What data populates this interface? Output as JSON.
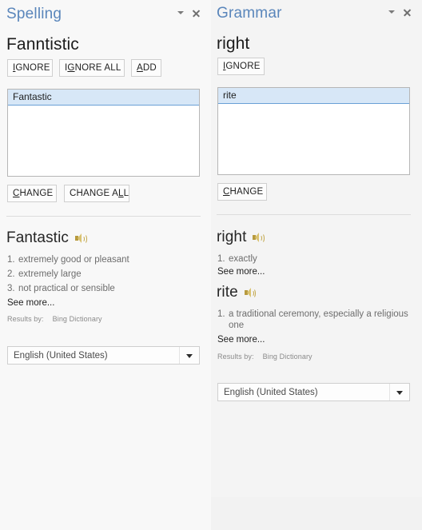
{
  "spelling": {
    "title": "Spelling",
    "header_icons": {
      "collapse": "chevron-down-icon",
      "close": "close-icon"
    },
    "flagged_word": "Fanntistic",
    "actions": [
      {
        "label": "IGNORE",
        "accel": "I"
      },
      {
        "label": "IGNORE ALL",
        "accel": "G"
      },
      {
        "label": "ADD",
        "accel": "A"
      }
    ],
    "suggestions": [
      "Fantastic"
    ],
    "selected_suggestion": "Fantastic",
    "change_actions": [
      {
        "label": "CHANGE",
        "accel": "C"
      },
      {
        "label": "CHANGE ALL",
        "accel": "L"
      }
    ],
    "definitions": [
      {
        "word": "Fantastic",
        "senses": [
          {
            "num": "1.",
            "text": "extremely good or pleasant"
          },
          {
            "num": "2.",
            "text": "extremely large"
          },
          {
            "num": "3.",
            "text": "not practical or sensible"
          }
        ],
        "see_more": "See more..."
      }
    ],
    "results_by_label": "Results by:",
    "results_by_source": "Bing Dictionary",
    "language": "English (United States)"
  },
  "grammar": {
    "title": "Grammar",
    "header_icons": {
      "collapse": "chevron-down-icon",
      "close": "close-icon"
    },
    "flagged_word": "right",
    "actions": [
      {
        "label": "IGNORE",
        "accel": "I"
      }
    ],
    "suggestions": [
      "rite"
    ],
    "selected_suggestion": "rite",
    "change_actions": [
      {
        "label": "CHANGE",
        "accel": "C"
      }
    ],
    "definitions": [
      {
        "word": "right",
        "senses": [
          {
            "num": "1.",
            "text": "exactly"
          }
        ],
        "see_more": "See more..."
      },
      {
        "word": "rite",
        "senses": [
          {
            "num": "1.",
            "text": "a traditional ceremony, especially a religious one"
          }
        ],
        "see_more": "See more..."
      }
    ],
    "results_by_label": "Results by:",
    "results_by_source": "Bing Dictionary",
    "language": "English (United States)"
  },
  "colors": {
    "title_blue": "#5a86bb",
    "selection_fill": "#d7e7f7",
    "selection_border": "#6aa0d6",
    "panel_bg": "#f8f8f8",
    "grammar_bg": "#f4f4f4",
    "speaker_gold": "#c2a64a"
  }
}
